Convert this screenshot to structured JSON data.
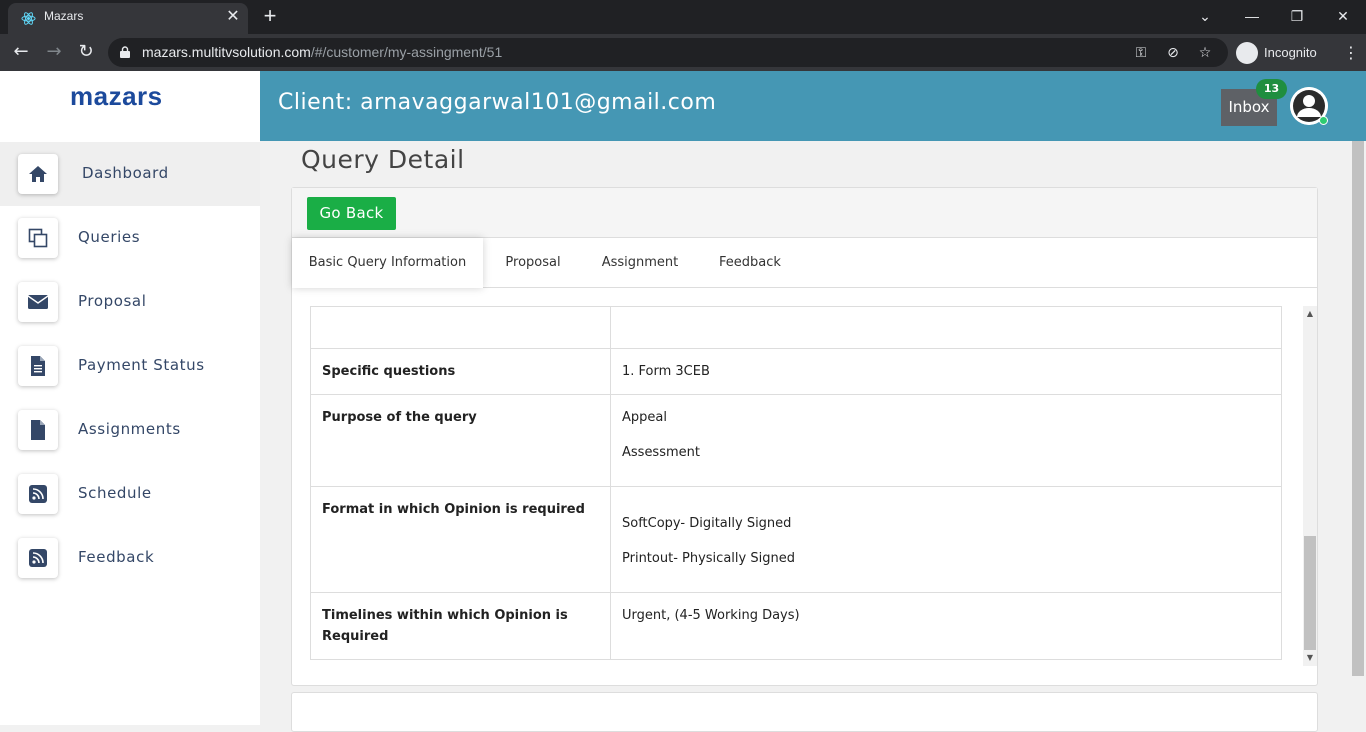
{
  "browser": {
    "tab_title": "Mazars",
    "url_host": "mazars.multitvsolution.com",
    "url_path": "/#/customer/my-assingment/51",
    "incognito_label": "Incognito"
  },
  "sidebar": {
    "logo": "mazars",
    "items": [
      {
        "label": "Dashboard",
        "icon": "home-icon",
        "active": true
      },
      {
        "label": "Queries",
        "icon": "copy-icon",
        "active": false
      },
      {
        "label": "Proposal",
        "icon": "envelope-icon",
        "active": false
      },
      {
        "label": "Payment Status",
        "icon": "file-text-icon",
        "active": false
      },
      {
        "label": "Assignments",
        "icon": "file-icon",
        "active": false
      },
      {
        "label": "Schedule",
        "icon": "rss-icon",
        "active": false
      },
      {
        "label": "Feedback",
        "icon": "rss-icon",
        "active": false
      }
    ]
  },
  "header": {
    "client_title": "Client: arnavaggarwal101@gmail.com",
    "inbox_label": "Inbox",
    "inbox_count": "13"
  },
  "main": {
    "page_title": "Query Detail",
    "go_back_label": "Go Back",
    "tabs": [
      {
        "label": "Basic Query Information",
        "active": true
      },
      {
        "label": "Proposal",
        "active": false
      },
      {
        "label": "Assignment",
        "active": false
      },
      {
        "label": "Feedback",
        "active": false
      }
    ],
    "rows": [
      {
        "label": "",
        "values": []
      },
      {
        "label": "Specific questions",
        "values": [
          "1. Form 3CEB"
        ]
      },
      {
        "label": "Purpose of the query",
        "values": [
          "Appeal",
          "Assessment"
        ]
      },
      {
        "label": "Format in which Opinion is required",
        "values": [
          "SoftCopy- Digitally Signed",
          "Printout- Physically Signed"
        ]
      },
      {
        "label": "Timelines within which Opinion is Required",
        "values": [
          "Urgent, (4-5 Working Days)"
        ]
      }
    ]
  },
  "colors": {
    "header_bg": "#4597b4",
    "go_back_bg": "#1aae46",
    "badge_bg": "#1f8e3f",
    "logo": "#1c4a9c"
  }
}
